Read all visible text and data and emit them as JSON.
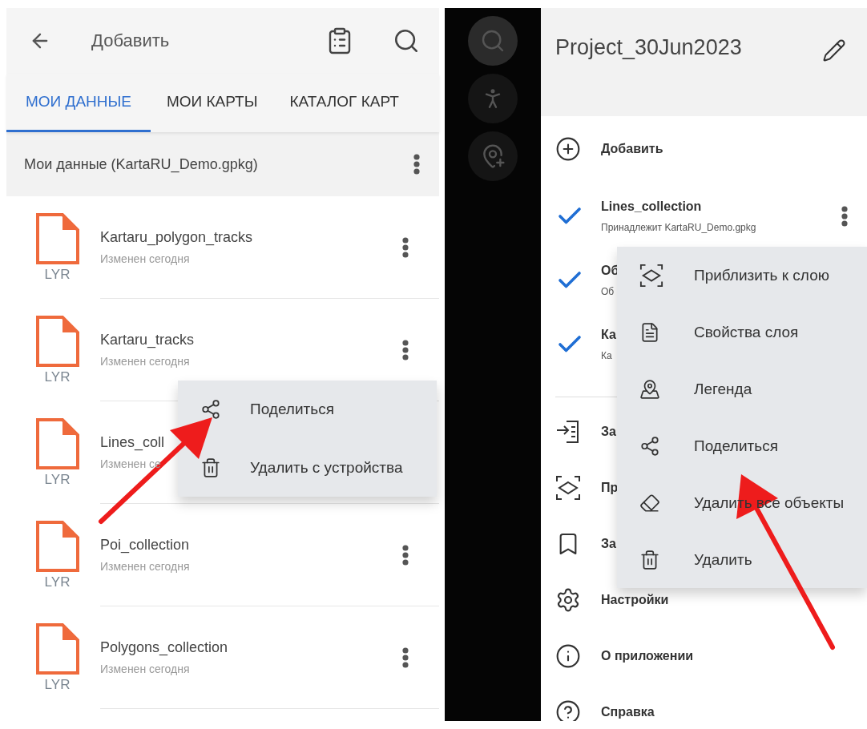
{
  "left_screen": {
    "header": {
      "title": "Добавить"
    },
    "tabs": [
      {
        "label": "МОИ ДАННЫЕ",
        "selected": true
      },
      {
        "label": "МОИ КАРТЫ",
        "selected": false
      },
      {
        "label": "КАТАЛОГ КАРТ",
        "selected": false
      }
    ],
    "group": {
      "title": "Мои данные (KartaRU_Demo.gpkg)"
    },
    "files": [
      {
        "name": "Kartaru_polygon_tracks",
        "subtitle": "Изменен сегодня",
        "type": "LYR",
        "more_button": true
      },
      {
        "name": "Kartaru_tracks",
        "subtitle": "Изменен сегодня",
        "type": "LYR",
        "more_button": true
      },
      {
        "name": "Lines_coll",
        "subtitle": "Изменен се",
        "type": "LYR",
        "more_button": false
      },
      {
        "name": "Poi_collection",
        "subtitle": "Изменен сегодня",
        "type": "LYR",
        "more_button": true
      },
      {
        "name": "Polygons_collection",
        "subtitle": "Изменен сегодня",
        "type": "LYR",
        "more_button": true
      }
    ],
    "context_menu": {
      "items": [
        {
          "kind": "share",
          "label": "Поделиться"
        },
        {
          "kind": "trash",
          "label": "Удалить с устройства"
        }
      ]
    }
  },
  "right_screen": {
    "fab_buttons": [
      {
        "kind": "search"
      },
      {
        "kind": "hiker"
      },
      {
        "kind": "pin-add"
      }
    ],
    "title": "Project_30Jun2023",
    "add_item": {
      "label": "Добавить"
    },
    "layers": [
      {
        "name": "Lines_collection",
        "subtitle": "Принадлежит KartaRU_Demo.gpkg",
        "checked": true,
        "more_button": true
      },
      {
        "name": "Об",
        "subtitle": "Об",
        "checked": true,
        "more_button": false
      },
      {
        "name": "Ка",
        "subtitle": "Ка",
        "checked": true,
        "more_button": false
      }
    ],
    "menu_items": [
      {
        "kind": "import",
        "label": "За"
      },
      {
        "kind": "zoom",
        "label": "Пр"
      },
      {
        "kind": "bookmark",
        "label": "За"
      },
      {
        "kind": "settings",
        "label": "Настройки"
      },
      {
        "kind": "info",
        "label": "О приложении"
      },
      {
        "kind": "help",
        "label": "Справка"
      }
    ],
    "context_menu": {
      "items": [
        {
          "kind": "zoom",
          "label": "Приблизить к слою"
        },
        {
          "kind": "properties",
          "label": "Свойства слоя"
        },
        {
          "kind": "legend",
          "label": "Легенда"
        },
        {
          "kind": "share",
          "label": "Поделиться"
        },
        {
          "kind": "erase",
          "label": "Удалить все объекты"
        },
        {
          "kind": "trash",
          "label": "Удалить"
        }
      ]
    }
  }
}
